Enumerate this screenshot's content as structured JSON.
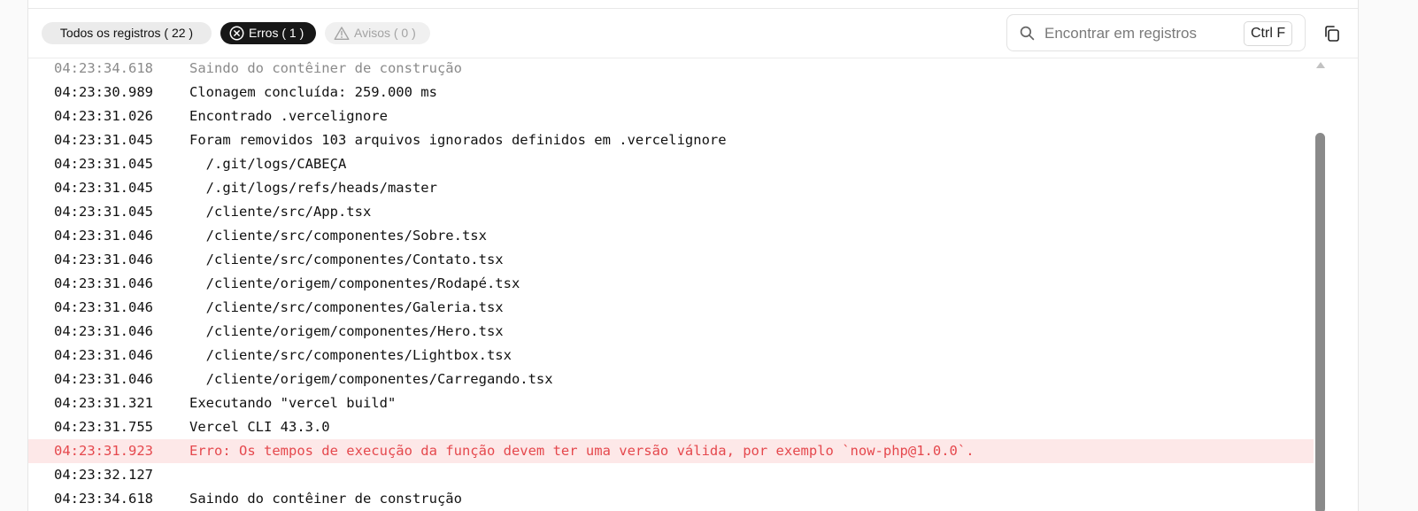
{
  "filters": {
    "all_label": "Todos os registros ( 22 )",
    "errors_label": "Erros ( 1 )",
    "warnings_label": "Avisos ( 0 )"
  },
  "search": {
    "placeholder": "Encontrar em registros",
    "shortcut": "Ctrl F"
  },
  "logs": [
    {
      "time": "04:23:34.618",
      "message": "Saindo do contêiner de construção"
    },
    {
      "time": "04:23:30.989",
      "message": "Clonagem concluída: 259.000 ms"
    },
    {
      "time": "04:23:31.026",
      "message": "Encontrado .vercelignore"
    },
    {
      "time": "04:23:31.045",
      "message": "Foram removidos 103 arquivos ignorados definidos em .vercelignore"
    },
    {
      "time": "04:23:31.045",
      "message": "  /.git/logs/CABEÇA"
    },
    {
      "time": "04:23:31.045",
      "message": "  /.git/logs/refs/heads/master"
    },
    {
      "time": "04:23:31.045",
      "message": "  /cliente/src/App.tsx"
    },
    {
      "time": "04:23:31.046",
      "message": "  /cliente/src/componentes/Sobre.tsx"
    },
    {
      "time": "04:23:31.046",
      "message": "  /cliente/src/componentes/Contato.tsx"
    },
    {
      "time": "04:23:31.046",
      "message": "  /cliente/origem/componentes/Rodapé.tsx"
    },
    {
      "time": "04:23:31.046",
      "message": "  /cliente/src/componentes/Galeria.tsx"
    },
    {
      "time": "04:23:31.046",
      "message": "  /cliente/origem/componentes/Hero.tsx"
    },
    {
      "time": "04:23:31.046",
      "message": "  /cliente/src/componentes/Lightbox.tsx"
    },
    {
      "time": "04:23:31.046",
      "message": "  /cliente/origem/componentes/Carregando.tsx"
    },
    {
      "time": "04:23:31.321",
      "message": "Executando \"vercel build\""
    },
    {
      "time": "04:23:31.755",
      "message": "Vercel CLI 43.3.0"
    },
    {
      "time": "04:23:31.923",
      "message": "Erro: Os tempos de execução da função devem ter uma versão válida, por exemplo `now-php@1.0.0`."
    },
    {
      "time": "04:23:32.127",
      "message": ""
    },
    {
      "time": "04:23:34.618",
      "message": "Saindo do contêiner de construção"
    }
  ],
  "colors": {
    "error_text": "#e5484d",
    "error_background": "#fde8e8",
    "active_chip": "#171717"
  }
}
